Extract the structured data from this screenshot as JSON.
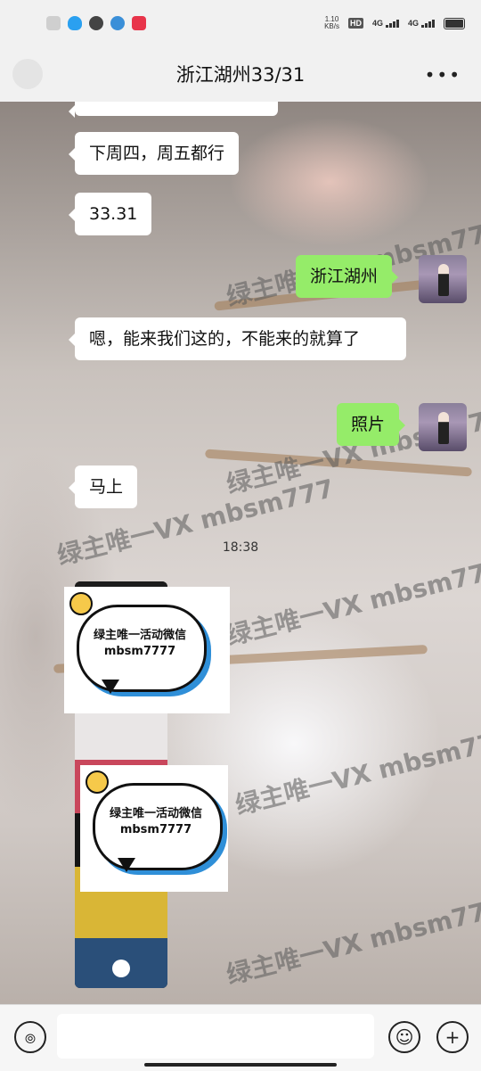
{
  "status_bar": {
    "net_speed": "1.10",
    "net_unit": "KB/s",
    "hd_label": "HD",
    "sim1": "4G",
    "sim2": "4G"
  },
  "header": {
    "title": "浙江湖州33/31",
    "more": "•••"
  },
  "messages": [
    {
      "side": "in",
      "text": "下周四，周五都行"
    },
    {
      "side": "in",
      "text": "33.31"
    },
    {
      "side": "out",
      "text": "浙江湖州"
    },
    {
      "side": "in",
      "text": "嗯，能来我们这的，不能来的就算了"
    },
    {
      "side": "out",
      "text": "照片"
    },
    {
      "side": "in",
      "text": "马上"
    }
  ],
  "timestamp": "18:38",
  "watermark": "绿主唯一VX mbsm777",
  "sticker": {
    "line1": "绿主唯一活动微信",
    "line2": "mbsm7777"
  },
  "colors": {
    "outgoing_bubble": "#95ec69",
    "incoming_bubble": "#ffffff",
    "header_bg": "#f1f1f1"
  },
  "icons": {
    "voice": "voice-icon",
    "emoji": "emoji-icon",
    "plus": "plus-icon"
  }
}
